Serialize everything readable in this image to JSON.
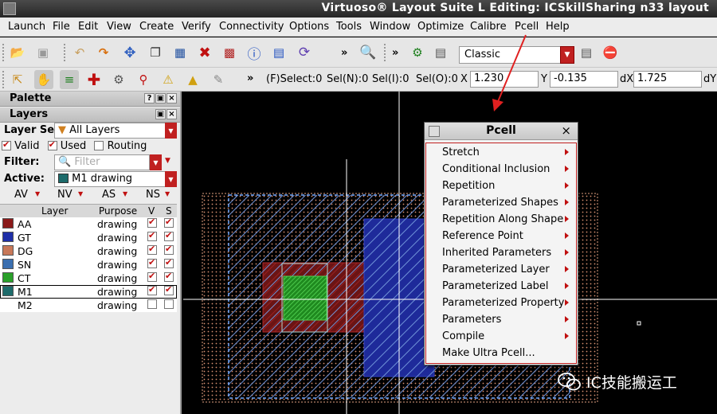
{
  "window": {
    "title": "Virtuoso® Layout Suite L Editing: ICSkillSharing n33 layout"
  },
  "menubar": [
    "Launch",
    "File",
    "Edit",
    "View",
    "Create",
    "Verify",
    "Connectivity",
    "Options",
    "Tools",
    "Window",
    "Optimize",
    "Calibre",
    "Pcell",
    "Help"
  ],
  "toolbar": {
    "workspace_value": "Classic",
    "chevron": "»"
  },
  "status": {
    "f_select": "(F)Select:0",
    "sel_n": "Sel(N):0",
    "sel_i": "Sel(I):0",
    "sel_o": "Sel(O):0",
    "x_label": "X",
    "x_value": "1.230",
    "y_label": "Y",
    "y_value": "-0.135",
    "dx_label": "dX",
    "dx_value": "1.725",
    "dy_label": "dY"
  },
  "palette": {
    "title": "Palette",
    "layers_title": "Layers",
    "layer_set_label": "Layer Se",
    "layer_set_value": "All Layers",
    "valid_label": "Valid",
    "used_label": "Used",
    "routing_label": "Routing",
    "filter_label": "Filter:",
    "filter_placeholder": "Filter",
    "active_label": "Active:",
    "active_value": "M1 drawing",
    "abbrevs": [
      "AV",
      "NV",
      "AS",
      "NS"
    ],
    "columns": {
      "layer": "Layer",
      "purpose": "Purpose",
      "v": "V",
      "s": "S"
    },
    "layers": [
      {
        "name": "AA",
        "purpose": "drawing",
        "v": true,
        "s": true,
        "color": "#8b1a1a"
      },
      {
        "name": "GT",
        "purpose": "drawing",
        "v": true,
        "s": true,
        "color": "#1f2fa8"
      },
      {
        "name": "DG",
        "purpose": "drawing",
        "v": true,
        "s": true,
        "color": "#c87858"
      },
      {
        "name": "SN",
        "purpose": "drawing",
        "v": true,
        "s": true,
        "color": "#3b6fb0"
      },
      {
        "name": "CT",
        "purpose": "drawing",
        "v": true,
        "s": true,
        "color": "#2aa02a"
      },
      {
        "name": "M1",
        "purpose": "drawing",
        "v": true,
        "s": true,
        "color": "#1d6b6b"
      },
      {
        "name": "M2",
        "purpose": "drawing",
        "v": false,
        "s": false,
        "color": ""
      }
    ]
  },
  "pcell_menu": {
    "title": "Pcell",
    "close": "×",
    "items": [
      {
        "label": "Stretch",
        "submenu": true
      },
      {
        "label": "Conditional Inclusion",
        "submenu": true
      },
      {
        "label": "Repetition",
        "submenu": true
      },
      {
        "label": "Parameterized Shapes",
        "submenu": true
      },
      {
        "label": "Repetition Along Shape",
        "submenu": true
      },
      {
        "label": "Reference Point",
        "submenu": true
      },
      {
        "label": "Inherited Parameters",
        "submenu": true
      },
      {
        "label": "Parameterized Layer",
        "submenu": true
      },
      {
        "label": "Parameterized Label",
        "submenu": true
      },
      {
        "label": "Parameterized Property",
        "submenu": true
      },
      {
        "label": "Parameters",
        "submenu": true
      },
      {
        "label": "Compile",
        "submenu": true
      },
      {
        "label": "Make Ultra Pcell...",
        "submenu": false
      }
    ]
  },
  "watermark": {
    "text": "IC技能搬运工"
  }
}
